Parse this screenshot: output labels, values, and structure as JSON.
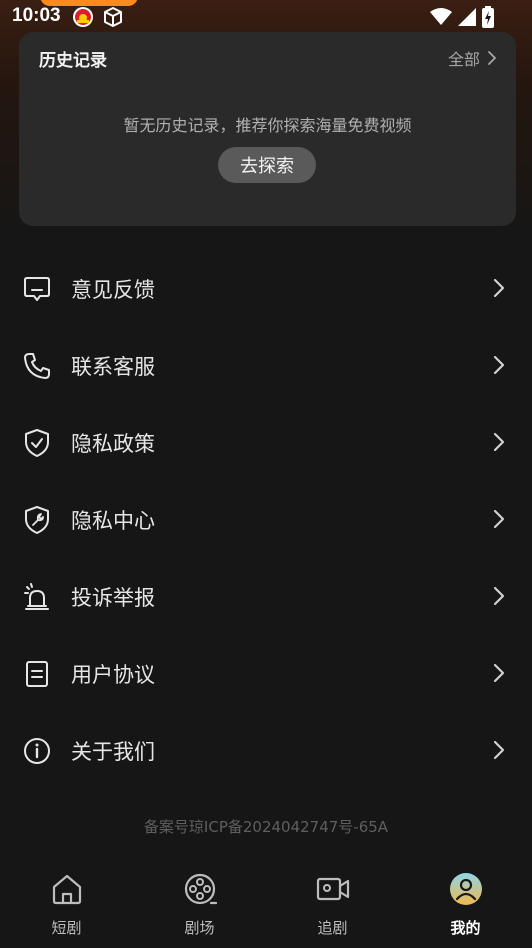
{
  "status_bar": {
    "time": "10:03",
    "left_icons": [
      "taiwan-flag-app-icon",
      "cube-icon"
    ],
    "right_icons": [
      "wifi-icon",
      "signal-icon",
      "battery-charging-icon"
    ]
  },
  "history": {
    "title": "历史记录",
    "all_label": "全部",
    "empty_text": "暂无历史记录，推荐你探索海量免费视频",
    "explore_button": "去探索"
  },
  "menu": {
    "items": [
      {
        "label": "意见反馈",
        "icon": "feedback-icon"
      },
      {
        "label": "联系客服",
        "icon": "phone-icon"
      },
      {
        "label": "隐私政策",
        "icon": "shield-check-icon"
      },
      {
        "label": "隐私中心",
        "icon": "shield-wrench-icon"
      },
      {
        "label": "投诉举报",
        "icon": "alarm-icon"
      },
      {
        "label": "用户协议",
        "icon": "document-icon"
      },
      {
        "label": "关于我们",
        "icon": "info-icon"
      }
    ]
  },
  "footer": {
    "icp": "备案号琼ICP备2024042747号-65A"
  },
  "bottom_nav": {
    "tabs": [
      {
        "label": "短剧",
        "icon": "home-icon"
      },
      {
        "label": "剧场",
        "icon": "film-reel-icon"
      },
      {
        "label": "追剧",
        "icon": "video-camera-icon"
      },
      {
        "label": "我的",
        "icon": "avatar-icon"
      }
    ],
    "active_index": 3
  },
  "colors": {
    "background": "#161616",
    "card": "#2a2a2a",
    "explore_button": "#5a5a5a",
    "status_pill": "#ff8a1c",
    "avatar_gradient_start": "#8fd6e8",
    "avatar_gradient_end": "#f2b94a"
  }
}
